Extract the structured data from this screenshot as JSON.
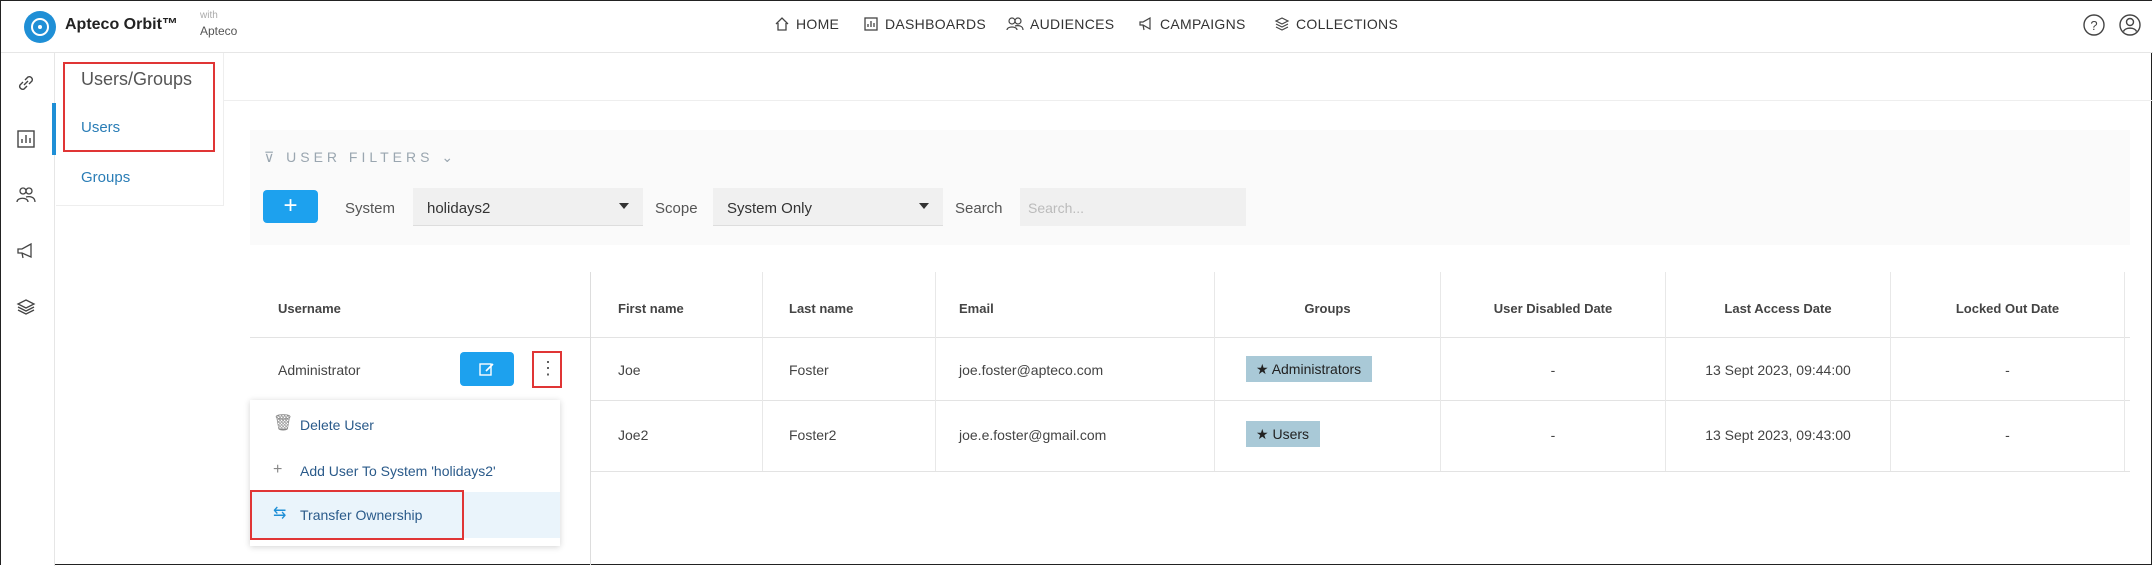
{
  "brand": {
    "name": "Apteco Orbit™",
    "with_small": "with",
    "with_brand": "Apteco"
  },
  "nav": [
    {
      "label": "HOME",
      "icon": "home-icon"
    },
    {
      "label": "DASHBOARDS",
      "icon": "dashboard-icon"
    },
    {
      "label": "AUDIENCES",
      "icon": "audiences-icon"
    },
    {
      "label": "CAMPAIGNS",
      "icon": "campaigns-icon"
    },
    {
      "label": "COLLECTIONS",
      "icon": "collections-icon"
    }
  ],
  "subnav": {
    "title": "Users/Groups",
    "users": "Users",
    "groups": "Groups"
  },
  "filters": {
    "title": "USER FILTERS",
    "add_label": "+",
    "system_label": "System",
    "system_value": "holidays2",
    "scope_label": "Scope",
    "scope_value": "System Only",
    "search_label": "Search",
    "search_placeholder": "Search..."
  },
  "table": {
    "username_header": "Username",
    "headers": [
      "First name",
      "Last name",
      "Email",
      "Groups",
      "User Disabled Date",
      "Last Access Date",
      "Locked Out Date"
    ],
    "rows": [
      {
        "username": "Administrator",
        "first": "Joe",
        "last": "Foster",
        "email": "joe.foster@apteco.com",
        "group": "Administrators",
        "disabled": "-",
        "last_access": "13 Sept 2023, 09:44:00",
        "locked": "-"
      },
      {
        "username": "",
        "first": "Joe2",
        "last": "Foster2",
        "email": "joe.e.foster@gmail.com",
        "group": "Users",
        "disabled": "-",
        "last_access": "13 Sept 2023, 09:43:00",
        "locked": "-"
      }
    ]
  },
  "menu": {
    "delete": "Delete User",
    "add": "Add User To System 'holidays2'",
    "transfer": "Transfer Ownership"
  },
  "colors": {
    "accent": "#1da1ee",
    "highlight": "#e03535",
    "badge": "#a9c9d7"
  }
}
